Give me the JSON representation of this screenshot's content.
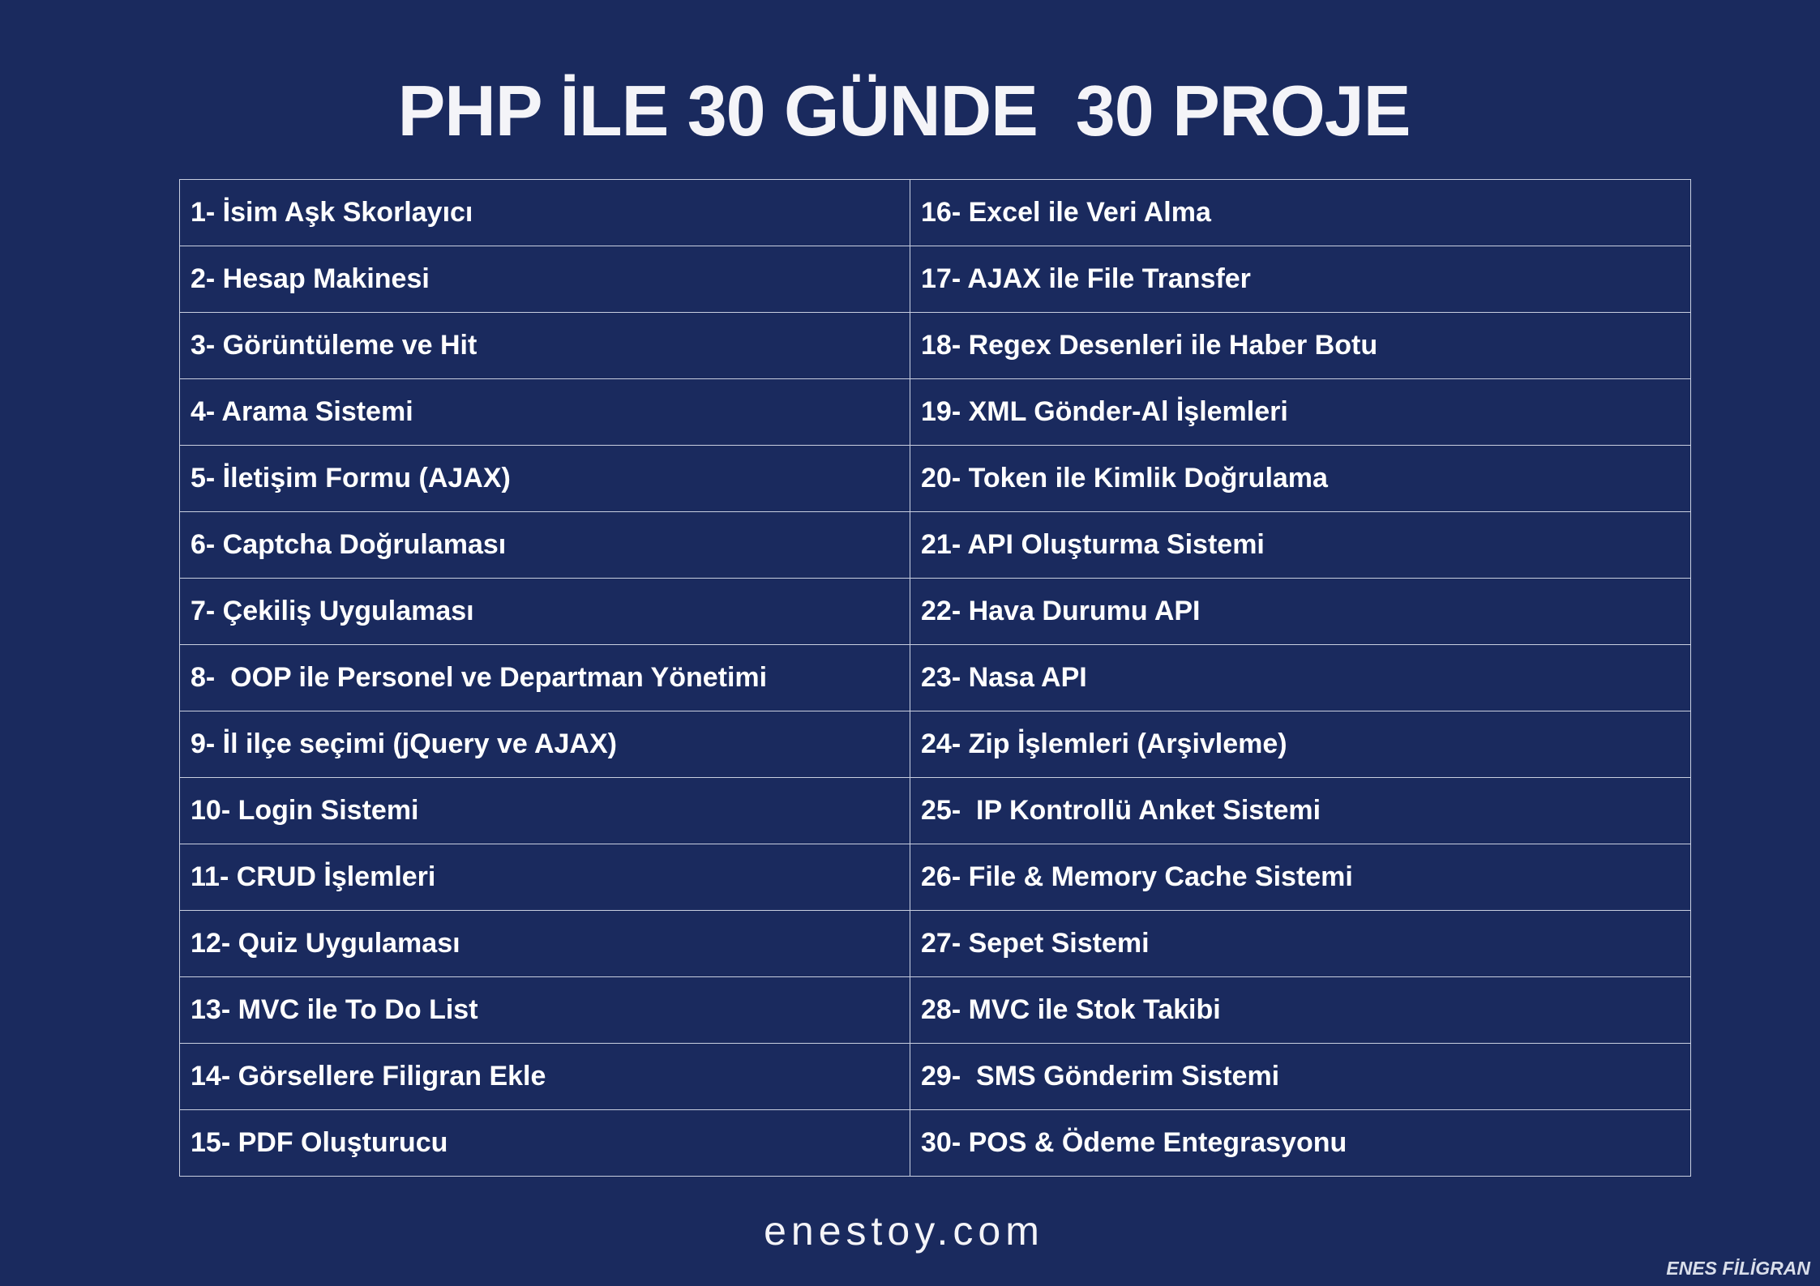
{
  "title": "PHP İLE 30 GÜNDE  30 PROJE",
  "projects": {
    "left": [
      "1- İsim Aşk Skorlayıcı",
      "2- Hesap Makinesi",
      "3- Görüntüleme ve Hit",
      "4- Arama Sistemi",
      "5- İletişim Formu (AJAX)",
      "6- Captcha Doğrulaması",
      "7- Çekiliş Uygulaması",
      "8-  OOP ile Personel ve Departman Yönetimi",
      "9- İl ilçe seçimi (jQuery ve AJAX)",
      "10- Login Sistemi",
      "11- CRUD İşlemleri",
      "12- Quiz Uygulaması",
      "13- MVC ile To Do List",
      "14- Görsellere Filigran Ekle",
      "15- PDF Oluşturucu"
    ],
    "right": [
      "16- Excel ile Veri Alma",
      "17- AJAX ile File Transfer",
      "18- Regex Desenleri ile Haber Botu",
      "19- XML Gönder-Al İşlemleri",
      "20- Token ile Kimlik Doğrulama",
      "21- API Oluşturma Sistemi",
      "22- Hava Durumu API",
      "23- Nasa API",
      "24- Zip İşlemleri (Arşivleme)",
      "25-  IP Kontrollü Anket Sistemi",
      "26- File & Memory Cache Sistemi",
      "27- Sepet Sistemi",
      "28- MVC ile Stok Takibi",
      "29-  SMS Gönderim Sistemi",
      "30- POS & Ödeme Entegrasyonu"
    ]
  },
  "footer": {
    "site": "enestoy.com"
  },
  "watermark": "ENES FİLİGRAN",
  "colors": {
    "background": "#1a2a5e",
    "text": "#ffffff",
    "grid_lines": "#c9cfe0"
  }
}
